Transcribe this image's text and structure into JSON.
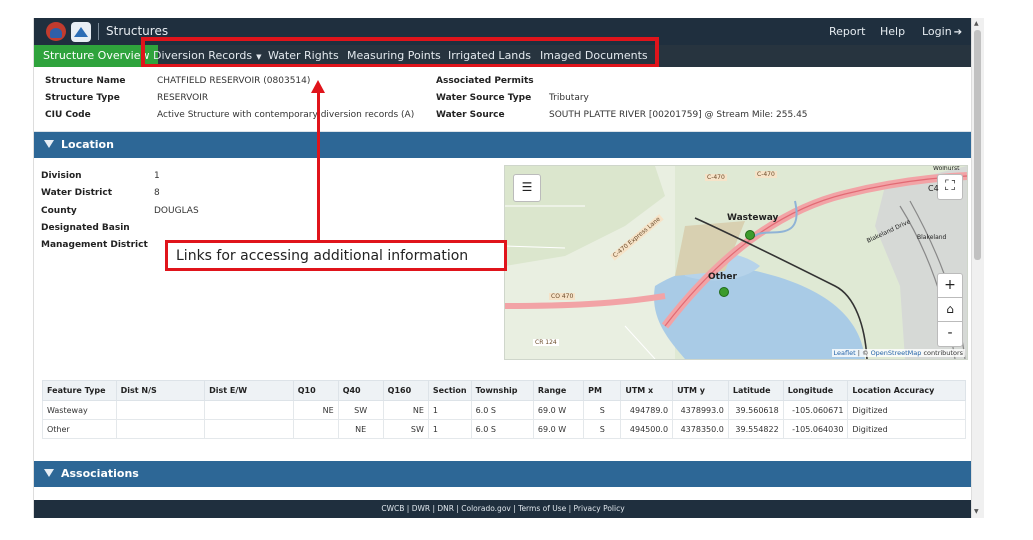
{
  "header": {
    "app_title": "Structures",
    "links": [
      "Report",
      "Help",
      "Login"
    ]
  },
  "tabs": {
    "active": "Structure Overview",
    "items": [
      "Diversion Records",
      "Water Rights",
      "Measuring Points",
      "Irrigated Lands",
      "Imaged Documents"
    ]
  },
  "structure": {
    "name_label": "Structure Name",
    "name_value": "CHATFIELD RESERVOIR (0803514)",
    "type_label": "Structure Type",
    "type_value": "RESERVOIR",
    "ciu_label": "CIU Code",
    "ciu_value": "Active Structure with contemporary diversion records (A)",
    "permits_label": "Associated Permits",
    "source_type_label": "Water Source Type",
    "source_type_value": "Tributary",
    "source_label": "Water Source",
    "source_value": "SOUTH PLATTE RIVER [00201759] @ Stream Mile: 255.45"
  },
  "location": {
    "section_title": "Location",
    "division_label": "Division",
    "division_value": "1",
    "water_district_label": "Water District",
    "water_district_value": "8",
    "county_label": "County",
    "county_value": "DOUGLAS",
    "basin_label": "Designated Basin",
    "mgmt_label": "Management District"
  },
  "map": {
    "labels": {
      "wasteway": "Wasteway",
      "other": "Other",
      "c470a": "C-470",
      "c470b": "C-470",
      "c470_express": "C-470 Express Lane",
      "co470": "CO 470",
      "cr124": "CR 124",
      "blakeland": "Blakeland",
      "blakeland_drive": "Blakeland Drive",
      "wolhurst": "Wolhurst",
      "c4": "C4"
    },
    "zoom_in": "+",
    "zoom_out": "-",
    "attribution_leaflet": "Leaflet",
    "attribution_sep": " | © ",
    "attribution_osm": "OpenStreetMap",
    "attribution_tail": " contributors"
  },
  "annotation": {
    "text": "Links for accessing additional information"
  },
  "table": {
    "headers": [
      "Feature Type",
      "Dist N/S",
      "Dist E/W",
      "Q10",
      "Q40",
      "Q160",
      "Section",
      "Township",
      "Range",
      "PM",
      "UTM x",
      "UTM y",
      "Latitude",
      "Longitude",
      "Location Accuracy"
    ],
    "rows": [
      [
        "Wasteway",
        "",
        "",
        "NE",
        "SW",
        "NE",
        "1",
        "6.0 S",
        "69.0 W",
        "S",
        "494789.0",
        "4378993.0",
        "39.560618",
        "-105.060671",
        "Digitized"
      ],
      [
        "Other",
        "",
        "",
        "",
        "NE",
        "SW",
        "1",
        "6.0 S",
        "69.0 W",
        "S",
        "494500.0",
        "4378350.0",
        "39.554822",
        "-105.064030",
        "Digitized"
      ]
    ]
  },
  "associations": {
    "section_title": "Associations"
  },
  "footer": {
    "text": "CWCB | DWR | DNR | Colorado.gov | Terms of Use | Privacy Policy"
  },
  "colors": {
    "header_bg": "#1f2f3e",
    "active_tab": "#2fa33c",
    "section_bg": "#2d6796",
    "annotation_red": "#e0141b"
  }
}
